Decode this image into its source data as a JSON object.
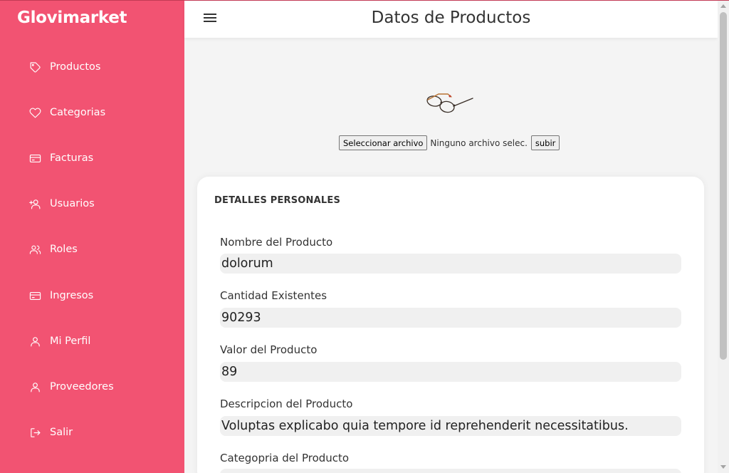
{
  "app": {
    "brand": "Glovimarket"
  },
  "sidebar": {
    "items": [
      {
        "label": "Productos",
        "icon": "tag-icon"
      },
      {
        "label": "Categorias",
        "icon": "heart-icon"
      },
      {
        "label": "Facturas",
        "icon": "credit-card-icon"
      },
      {
        "label": "Usuarios",
        "icon": "user-plus-icon"
      },
      {
        "label": "Roles",
        "icon": "users-icon"
      },
      {
        "label": "Ingresos",
        "icon": "credit-card-icon"
      },
      {
        "label": "Mi Perfil",
        "icon": "user-icon"
      },
      {
        "label": "Proveedores",
        "icon": "user-icon"
      },
      {
        "label": "Salir",
        "icon": "logout-icon"
      }
    ]
  },
  "header": {
    "title": "Datos de Productos",
    "menu_icon": "hamburger-icon"
  },
  "upload": {
    "select_label": "Seleccionar archivo",
    "status": "Ninguno archivo selec.",
    "submit_label": "subir"
  },
  "card": {
    "title": "DETALLES PERSONALES",
    "fields": [
      {
        "label": "Nombre del Producto",
        "value": "dolorum"
      },
      {
        "label": "Cantidad Existentes",
        "value": "90293"
      },
      {
        "label": "Valor del Producto",
        "value": "89"
      },
      {
        "label": "Descripcion del Producto",
        "value": "Voluptas explicabo quia tempore id reprehenderit necessitatibus."
      },
      {
        "label": "Categopria del Producto",
        "value": ""
      }
    ]
  },
  "colors": {
    "sidebar": "#f25372",
    "header": "#ffffff",
    "background": "#f4f4f4",
    "field_bg": "#f0f0f0"
  }
}
